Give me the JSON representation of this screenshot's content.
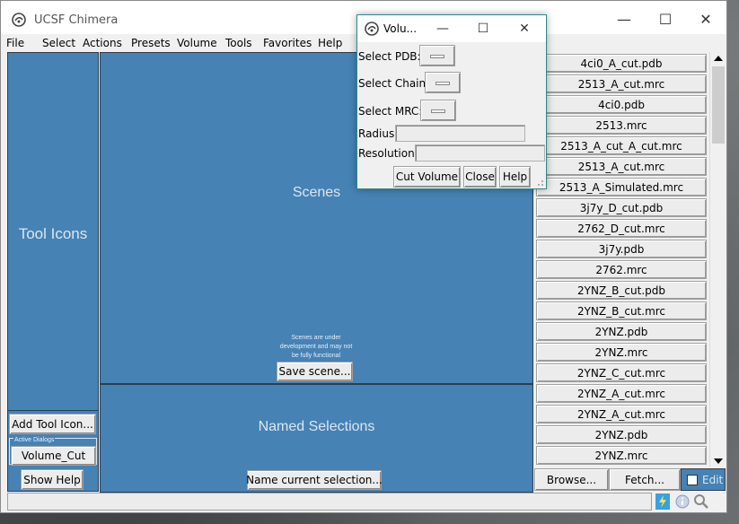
{
  "window": {
    "title": "UCSF Chimera",
    "controls": {
      "minimize": "—",
      "maximize": "☐",
      "close": "✕"
    }
  },
  "menubar": [
    "File",
    "Select",
    "Actions",
    "Presets",
    "Volume",
    "Tools",
    "Favorites",
    "Help"
  ],
  "left_panel": {
    "label": "Tool Icons",
    "add_tool_button": "Add Tool Icon...",
    "active_dialogs_label": "Active Dialogs",
    "active_dialog_button": "Volume_Cut",
    "show_help_button": "Show Help"
  },
  "scenes": {
    "label": "Scenes",
    "note": "Scenes are under development and may not be fully functional",
    "save_button": "Save scene..."
  },
  "named_selections": {
    "label": "Named Selections",
    "name_button": "Name current selection..."
  },
  "file_list": [
    "4ci0_A_cut.pdb",
    "2513_A_cut.mrc",
    "4ci0.pdb",
    "2513.mrc",
    "2513_A_cut_A_cut.mrc",
    "2513_A_cut.mrc",
    "2513_A_Simulated.mrc",
    "3j7y_D_cut.pdb",
    "2762_D_cut.mrc",
    "3j7y.pdb",
    "2762.mrc",
    "2YNZ_B_cut.pdb",
    "2YNZ_B_cut.mrc",
    "2YNZ.pdb",
    "2YNZ.mrc",
    "2YNZ_C_cut.mrc",
    "2YNZ_A_cut.mrc",
    "2YNZ_A_cut.mrc",
    "2YNZ.pdb",
    "2YNZ.mrc"
  ],
  "bottom_buttons": {
    "browse": "Browse...",
    "fetch": "Fetch...",
    "edit": "Edit"
  },
  "dialog": {
    "title": "Volu...",
    "controls": {
      "minimize": "—",
      "maximize": "☐",
      "close": "✕"
    },
    "select_pdb": "Select PDB:",
    "select_chain": "Select Chain:",
    "select_mrc": "Select MRC:",
    "radius": "Radius:",
    "resolution": "Resolution:",
    "cut_volume_button": "Cut Volume",
    "close_button": "Close",
    "help_button": "Help"
  },
  "colors": {
    "panel_blue": "#4682b4",
    "chrome": "#f0f0f0"
  }
}
